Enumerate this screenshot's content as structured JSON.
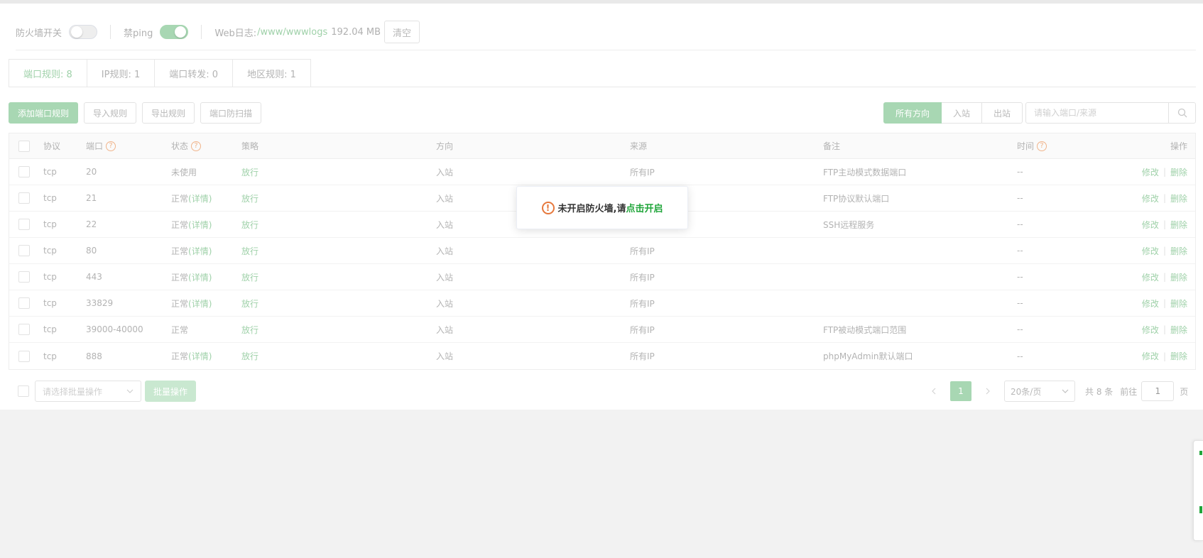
{
  "toolbar": {
    "firewall_label": "防火墙开关",
    "firewall_on": false,
    "ping_label": "禁ping",
    "ping_on": true,
    "weblog_label": "Web日志:",
    "weblog_path": "/www/wwwlogs",
    "weblog_size": "192.04 MB",
    "clear_label": "清空"
  },
  "tabs": [
    {
      "label": "端口规则: 8",
      "active": true
    },
    {
      "label": "IP规则: 1",
      "active": false
    },
    {
      "label": "端口转发: 0",
      "active": false
    },
    {
      "label": "地区规则: 1",
      "active": false
    }
  ],
  "actions": {
    "add": "添加端口规则",
    "import": "导入规则",
    "export": "导出规则",
    "scan": "端口防扫描"
  },
  "direction_filter": {
    "all": "所有方向",
    "inbound": "入站",
    "outbound": "出站",
    "selected": "所有方向"
  },
  "search": {
    "placeholder": "请输入端口/来源"
  },
  "table": {
    "headers": {
      "protocol": "协议",
      "port": "端口",
      "status": "状态",
      "policy": "策略",
      "direction": "方向",
      "source": "来源",
      "note": "备注",
      "time": "时间",
      "ops": "操作"
    },
    "help_mark": "?",
    "rows": [
      {
        "protocol": "tcp",
        "port": "20",
        "status": "未使用",
        "detail": "",
        "policy": "放行",
        "direction": "入站",
        "source": "所有IP",
        "note": "FTP主动模式数据端口",
        "time": "--",
        "edit": "修改",
        "delete": "删除"
      },
      {
        "protocol": "tcp",
        "port": "21",
        "status": "正常",
        "detail": "(详情)",
        "policy": "放行",
        "direction": "入站",
        "source": "",
        "note": "FTP协议默认端口",
        "time": "--",
        "edit": "修改",
        "delete": "删除"
      },
      {
        "protocol": "tcp",
        "port": "22",
        "status": "正常",
        "detail": "(详情)",
        "policy": "放行",
        "direction": "入站",
        "source": "",
        "note": "SSH远程服务",
        "time": "--",
        "edit": "修改",
        "delete": "删除"
      },
      {
        "protocol": "tcp",
        "port": "80",
        "status": "正常",
        "detail": "(详情)",
        "policy": "放行",
        "direction": "入站",
        "source": "所有IP",
        "note": "",
        "time": "--",
        "edit": "修改",
        "delete": "删除"
      },
      {
        "protocol": "tcp",
        "port": "443",
        "status": "正常",
        "detail": "(详情)",
        "policy": "放行",
        "direction": "入站",
        "source": "所有IP",
        "note": "",
        "time": "--",
        "edit": "修改",
        "delete": "删除"
      },
      {
        "protocol": "tcp",
        "port": "33829",
        "status": "正常",
        "detail": "(详情)",
        "policy": "放行",
        "direction": "入站",
        "source": "所有IP",
        "note": "",
        "time": "--",
        "edit": "修改",
        "delete": "删除"
      },
      {
        "protocol": "tcp",
        "port": "39000-40000",
        "status": "正常",
        "detail": "",
        "policy": "放行",
        "direction": "入站",
        "source": "所有IP",
        "note": "FTP被动模式端口范围",
        "time": "--",
        "edit": "修改",
        "delete": "删除"
      },
      {
        "protocol": "tcp",
        "port": "888",
        "status": "正常",
        "detail": "(详情)",
        "policy": "放行",
        "direction": "入站",
        "source": "所有IP",
        "note": "phpMyAdmin默认端口",
        "time": "--",
        "edit": "修改",
        "delete": "删除"
      }
    ]
  },
  "toast": {
    "icon_glyph": "!",
    "message": "未开启防火墙,请",
    "link": "点击开启"
  },
  "footer": {
    "batch_placeholder": "请选择批量操作",
    "batch_button": "批量操作",
    "current_page": "1",
    "page_size": "20条/页",
    "total": "共 8 条",
    "goto_label": "前往",
    "goto_value": "1",
    "page_unit": "页"
  },
  "colors": {
    "accent_green": "#20a53a",
    "muted_green": "#a8d7b3",
    "warning_orange": "#e6783c"
  }
}
